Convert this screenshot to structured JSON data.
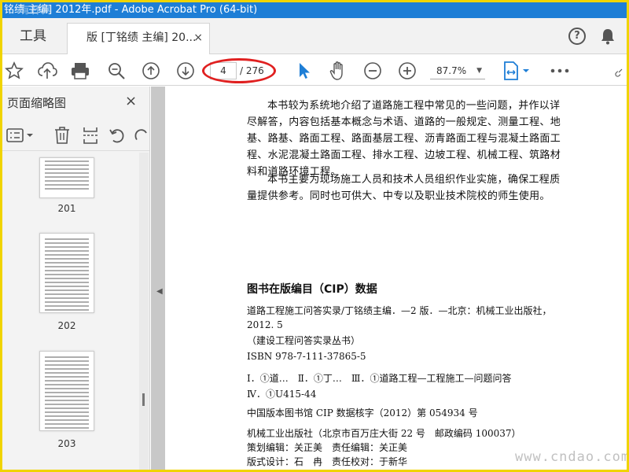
{
  "window": {
    "title": "铭绩 主编] 2012年.pdf - Adobe Acrobat Pro (64-bit)",
    "watermark_badge": "有杯网"
  },
  "tabs": {
    "tools_label": "工具",
    "document_label": "版 [丁铭绩 主编] 20...",
    "close_glyph": "×"
  },
  "header_icons": {
    "help": "help-icon",
    "notifications": "bell-icon"
  },
  "toolbar": {
    "current_page": "4",
    "total_pages": "/ 276",
    "zoom": "87.7%",
    "icons": [
      "bookmark-star-icon",
      "upload-icon",
      "print-icon",
      "zoom-out-search-icon",
      "page-up-icon",
      "page-down-icon",
      "select-cursor-icon",
      "hand-tool-icon",
      "zoom-minus-icon",
      "zoom-plus-icon",
      "fit-page-icon",
      "more-icon"
    ],
    "accent": "#1e7ed6"
  },
  "sidebar": {
    "title": "页面缩略图",
    "close_glyph": "×",
    "thumbnails": [
      {
        "label": "201"
      },
      {
        "label": "202"
      },
      {
        "label": "203"
      }
    ]
  },
  "document": {
    "paragraph1": "本书较为系统地介绍了道路施工程中常见的一些问题，并作以详尽解答，内容包括基本概念与术语、道路的一般规定、测量工程、地基、路基、路面工程、路面基层工程、沥青路面工程与混凝土路面工程、水泥混凝土路面工程、排水工程、边坡工程、机械工程、筑路材料和道路环境工程。",
    "paragraph2": "本书主要为现场施工人员和技术人员组织作业实施，确保工程质量提供参考。同时也可供大、中专以及职业技术院校的师生使用。",
    "cip_title": "图书在版编目（CIP）数据",
    "cip_line1": "道路工程施工问答实录/丁铭绩主编．—2 版．—北京：机械工业出版社，2012. 5",
    "cip_line2": "（建设工程问答实录丛书）",
    "cip_line3": "ISBN 978-7-111-37865-5",
    "cip_line4": "Ⅰ．①道…　Ⅱ．①丁…　Ⅲ．①道路工程—工程施工—问题问答",
    "cip_line5": "Ⅳ．①U415-44",
    "cip_line6": "中国版本图书馆 CIP 数据核字（2012）第 054934 号",
    "cip_line7": "机械工业出版社（北京市百万庄大街 22 号　邮政编码 100037）",
    "cip_line8": "策划编辑：关正美　责任编辑：关正美",
    "cip_line9": "版式设计：石　冉　责任校对：于新华"
  },
  "site_watermark": "www.cndao.com"
}
